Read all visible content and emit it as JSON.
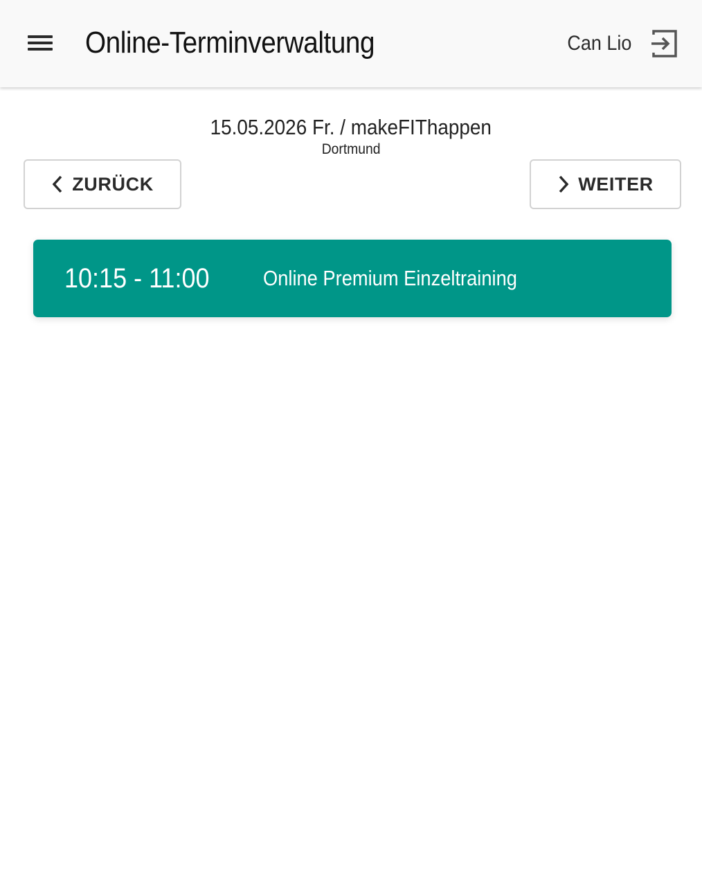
{
  "header": {
    "title": "Online-Terminverwaltung",
    "user_name": "Can Lio",
    "menu_icon": "hamburger-menu-icon",
    "logout_icon": "logout-icon"
  },
  "day": {
    "heading": "15.05.2026 Fr. / makeFIThappen",
    "location": "Dortmund"
  },
  "navigation": {
    "back_label": "ZURÜCK",
    "next_label": "WEITER"
  },
  "appointments": [
    {
      "time": "10:15 - 11:00",
      "title": "Online Premium Einzeltraining"
    }
  ],
  "colors": {
    "accent": "#009688",
    "appbar": "#f9f9f9"
  }
}
